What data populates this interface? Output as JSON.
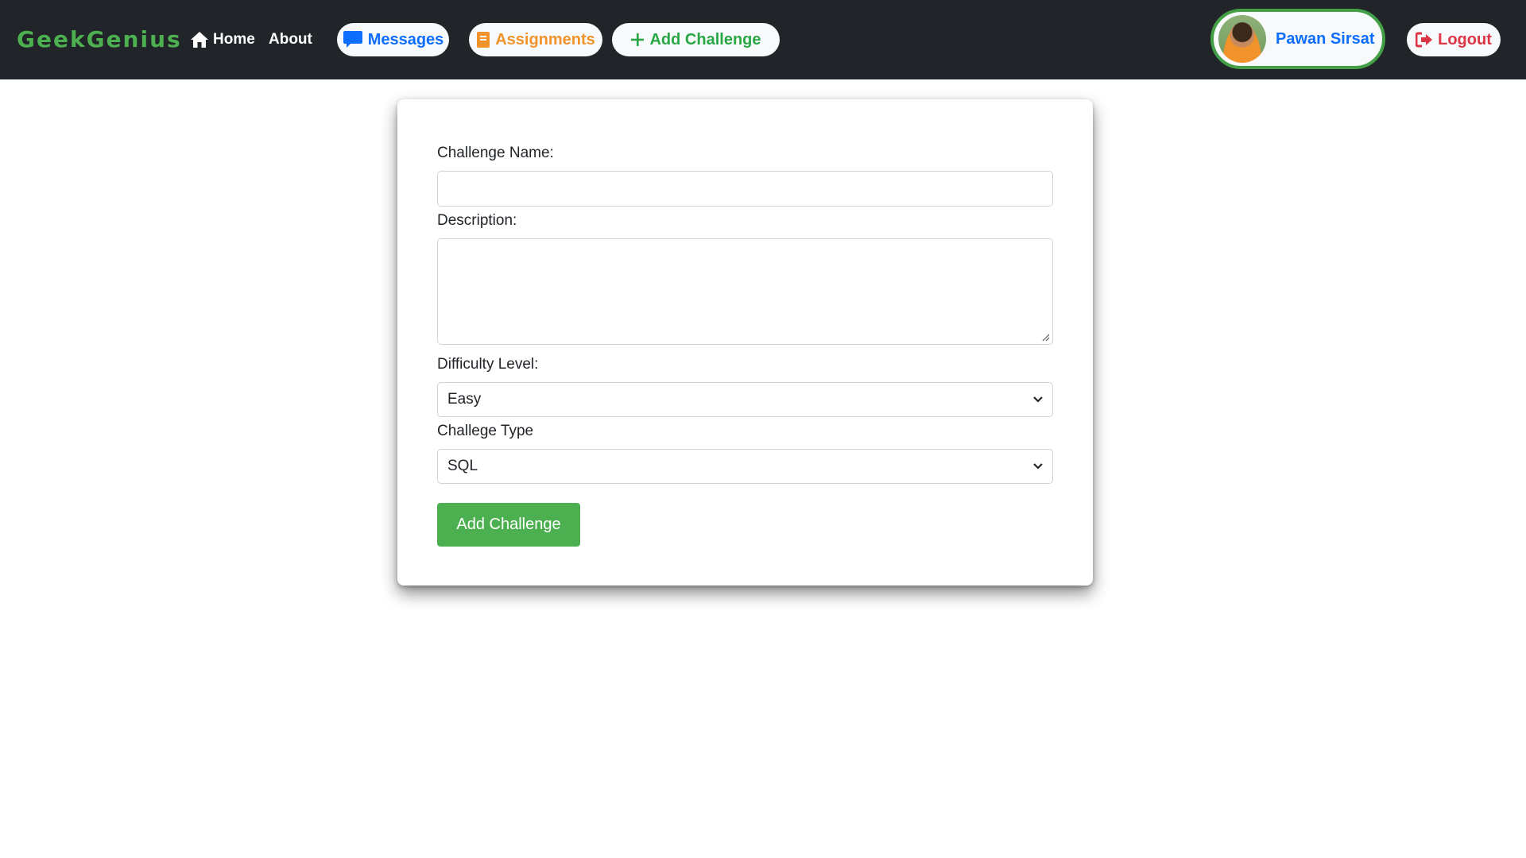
{
  "navbar": {
    "brand": "GeekGenius",
    "home_label": "Home",
    "about_label": "About",
    "messages_label": "Messages",
    "assignments_label": "Assignments",
    "add_challenge_label": "Add Challenge",
    "user_name": "Pawan Sirsat",
    "logout_label": "Logout"
  },
  "form": {
    "name_label": "Challenge Name:",
    "name_value": "",
    "description_label": "Description:",
    "description_value": "",
    "difficulty_label": "Difficulty Level:",
    "difficulty_value": "Easy",
    "type_label": "Challege Type",
    "type_value": "SQL",
    "submit_label": "Add Challenge"
  },
  "colors": {
    "navbar_bg": "#212529",
    "brand": "#4caf50",
    "messages": "#0d6efd",
    "assignments": "#f0932b",
    "add_challenge": "#28a745",
    "logout": "#dc3545",
    "submit_bg": "#4caf50"
  },
  "icons": {
    "home": "home-icon",
    "messages": "chat-bubble-icon",
    "assignments": "book-icon",
    "add": "plus-icon",
    "logout": "sign-out-icon",
    "select": "chevron-down-icon",
    "resize": "resize-grip-icon"
  }
}
